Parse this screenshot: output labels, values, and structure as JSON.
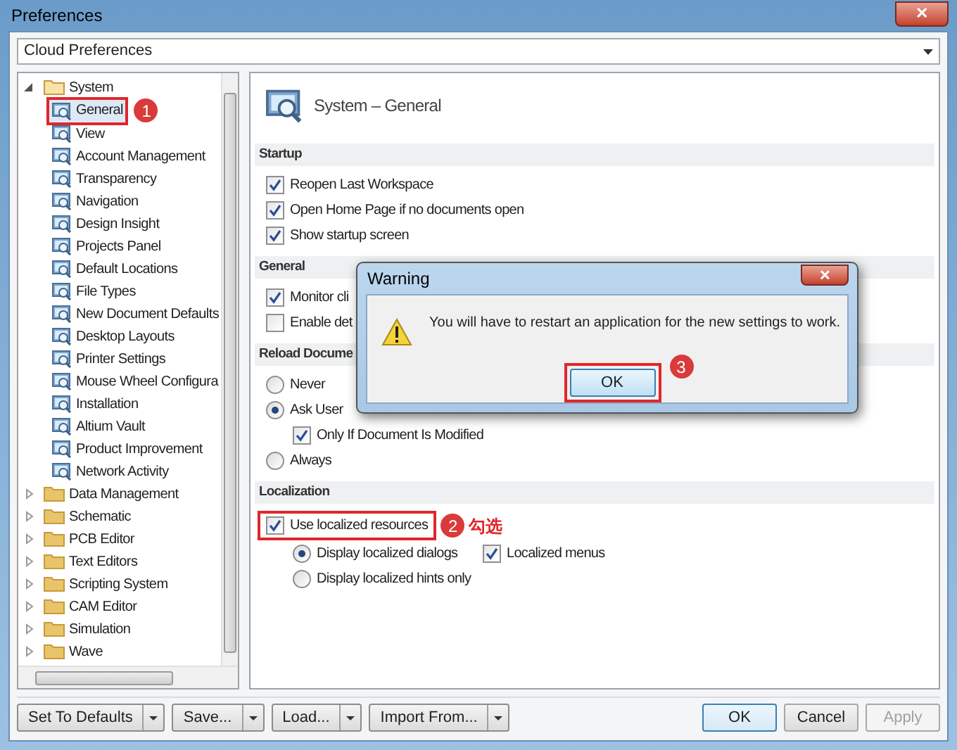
{
  "window": {
    "title": "Preferences",
    "close_label": "✕"
  },
  "profile_dropdown": {
    "value": "Cloud Preferences"
  },
  "tree": [
    {
      "label": "System",
      "kind": "folder",
      "expanded": true,
      "selected": false,
      "children": [
        {
          "label": "General",
          "kind": "page",
          "selected": true,
          "callout": "1"
        },
        {
          "label": "View",
          "kind": "page",
          "selected": false
        },
        {
          "label": "Account Management",
          "kind": "page",
          "selected": false
        },
        {
          "label": "Transparency",
          "kind": "page",
          "selected": false
        },
        {
          "label": "Navigation",
          "kind": "page",
          "selected": false
        },
        {
          "label": "Design Insight",
          "kind": "page",
          "selected": false
        },
        {
          "label": "Projects Panel",
          "kind": "page",
          "selected": false
        },
        {
          "label": "Default Locations",
          "kind": "page",
          "selected": false
        },
        {
          "label": "File Types",
          "kind": "page",
          "selected": false
        },
        {
          "label": "New Document Defaults",
          "kind": "page",
          "selected": false
        },
        {
          "label": "Desktop Layouts",
          "kind": "page",
          "selected": false
        },
        {
          "label": "Printer Settings",
          "kind": "page",
          "selected": false
        },
        {
          "label": "Mouse Wheel Configura",
          "kind": "page",
          "selected": false
        },
        {
          "label": "Installation",
          "kind": "page",
          "selected": false
        },
        {
          "label": "Altium Vault",
          "kind": "page",
          "selected": false
        },
        {
          "label": "Product Improvement",
          "kind": "page",
          "selected": false
        },
        {
          "label": "Network Activity",
          "kind": "page",
          "selected": false
        }
      ]
    },
    {
      "label": "Data Management",
      "kind": "folder",
      "expanded": false,
      "selected": false
    },
    {
      "label": "Schematic",
      "kind": "folder",
      "expanded": false,
      "selected": false
    },
    {
      "label": "PCB Editor",
      "kind": "folder",
      "expanded": false,
      "selected": false
    },
    {
      "label": "Text Editors",
      "kind": "folder",
      "expanded": false,
      "selected": false
    },
    {
      "label": "Scripting System",
      "kind": "folder",
      "expanded": false,
      "selected": false
    },
    {
      "label": "CAM Editor",
      "kind": "folder",
      "expanded": false,
      "selected": false
    },
    {
      "label": "Simulation",
      "kind": "folder",
      "expanded": false,
      "selected": false
    },
    {
      "label": "Wave",
      "kind": "folder",
      "expanded": false,
      "selected": false
    }
  ],
  "page_title": "System – General",
  "sections": [
    {
      "title": "Startup",
      "controls": [
        {
          "kind": "checkbox",
          "label": "Reopen Last Workspace",
          "checked": true
        },
        {
          "kind": "checkbox",
          "label": "Open Home Page if no documents open",
          "checked": true
        },
        {
          "kind": "checkbox",
          "label": "Show startup screen",
          "checked": true
        }
      ]
    },
    {
      "title": "General",
      "controls": [
        {
          "kind": "checkbox",
          "label": "Monitor cli",
          "checked": true
        },
        {
          "kind": "checkbox",
          "label": "Enable det",
          "checked": false
        }
      ]
    },
    {
      "title": "Reload Docume",
      "controls": [
        {
          "kind": "radio",
          "label": "Never",
          "checked": false
        },
        {
          "kind": "radio",
          "label": "Ask User",
          "checked": true,
          "children": [
            {
              "kind": "checkbox",
              "label": "Only If Document Is Modified",
              "checked": true
            }
          ]
        },
        {
          "kind": "radio",
          "label": "Always",
          "checked": false
        }
      ]
    },
    {
      "title": "Localization",
      "controls": [
        {
          "kind": "checkbox",
          "label": "Use localized resources",
          "checked": true,
          "callout": "2",
          "note": "勾选",
          "children": [
            {
              "kind": "radio",
              "label": "Display localized dialogs",
              "checked": true
            },
            {
              "kind": "checkbox",
              "label": "Localized menus",
              "checked": true
            },
            {
              "kind": "radio",
              "label": "Display localized hints only",
              "checked": false
            }
          ]
        }
      ]
    }
  ],
  "footer_left": [
    {
      "label": "Set To Defaults"
    },
    {
      "label": "Save..."
    },
    {
      "label": "Load..."
    },
    {
      "label": "Import From..."
    }
  ],
  "footer_right": [
    {
      "label": "OK",
      "disabled": false,
      "default": true
    },
    {
      "label": "Cancel",
      "disabled": false,
      "default": false
    },
    {
      "label": "Apply",
      "disabled": true,
      "default": false
    }
  ],
  "dialog": {
    "title": "Warning",
    "close_label": "✕",
    "message": "You will have to restart an application for the new settings to work.",
    "button": {
      "label": "OK",
      "callout": "3"
    }
  }
}
